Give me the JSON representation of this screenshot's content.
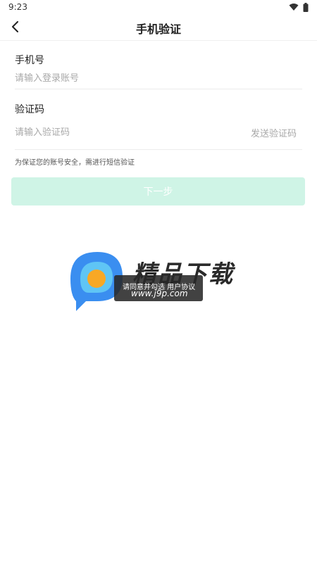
{
  "status_bar": {
    "time": "9:23",
    "icons": [
      "wifi-icon",
      "battery-icon"
    ]
  },
  "nav": {
    "title": "手机验证",
    "back_icon": "chevron-left-icon"
  },
  "form": {
    "phone": {
      "label": "手机号",
      "placeholder": "请输入登录账号",
      "value": ""
    },
    "code": {
      "label": "验证码",
      "placeholder": "请输入验证码",
      "value": "",
      "send_label": "发送验证码"
    },
    "hint": "为保证您的账号安全，需进行短信验证",
    "next_label": "下一步"
  },
  "toast": {
    "text": "请同意并勾选 用户协议"
  },
  "watermark": {
    "text": "精品下载",
    "url": "www.j9p.com"
  },
  "colors": {
    "next_button_bg": "#cff4e6",
    "placeholder": "#a8a8a8",
    "divider": "#ececec"
  }
}
